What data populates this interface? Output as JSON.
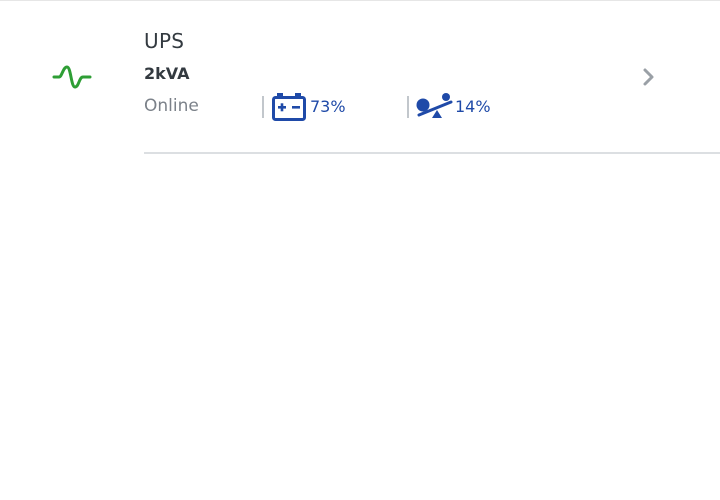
{
  "device": {
    "title": "UPS",
    "subtitle": "2kVA",
    "status": "Online",
    "status_icon": "waveform-icon",
    "battery": {
      "icon": "battery-icon",
      "value": "73%"
    },
    "load": {
      "icon": "load-icon",
      "value": "14%"
    },
    "chevron_icon": "chevron-right-icon"
  },
  "colors": {
    "status_green": "#2e9e35",
    "value_blue": "#1f4aa8",
    "text_dark": "#333a40",
    "text_muted": "#7b8189",
    "separator": "#c2c7cc",
    "chevron": "#9aa0a6"
  }
}
